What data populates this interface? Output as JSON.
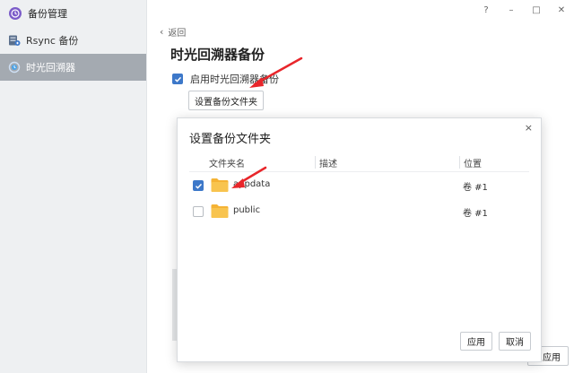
{
  "window": {
    "help_glyph": "?",
    "minimize_glyph": "–",
    "maximize_glyph": "□",
    "close_glyph": "✕"
  },
  "sidebar": {
    "app_title": "备份管理",
    "app_icon": "clock-icon",
    "items": [
      {
        "label": "Rsync 备份",
        "icon": "server-icon",
        "active": false
      },
      {
        "label": "时光回溯器",
        "icon": "time-machine-icon",
        "active": true
      }
    ]
  },
  "main": {
    "back_label": "返回",
    "title": "时光回溯器备份",
    "enable_label": "启用时光回溯器备份",
    "enable_checked": true,
    "set_folder_button": "设置备份文件夹",
    "apply_label": "应用"
  },
  "dialog": {
    "title": "设置备份文件夹",
    "close_glyph": "×",
    "columns": {
      "name": "文件夹名",
      "description": "描述",
      "location": "位置"
    },
    "rows": [
      {
        "checked": true,
        "name": "appdata",
        "description": "",
        "location": "卷 #1"
      },
      {
        "checked": false,
        "name": "public",
        "description": "",
        "location": "卷 #1"
      }
    ],
    "apply_button": "应用",
    "cancel_button": "取消"
  },
  "colors": {
    "accent": "#3d78c9",
    "sidebar_bg": "#eef0f2",
    "sidebar_active": "#a4aab1",
    "folder": "#f5b335",
    "annotation_arrow": "#e8262b"
  }
}
